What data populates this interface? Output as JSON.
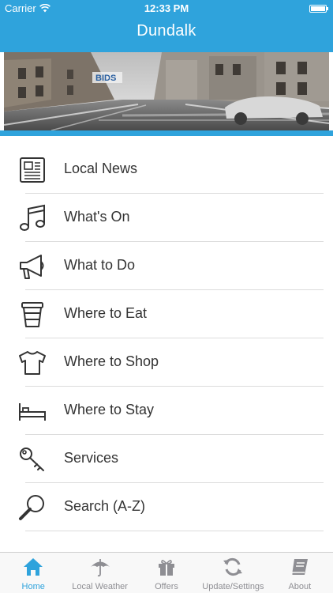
{
  "status_bar": {
    "carrier": "Carrier",
    "time": "12:33 PM"
  },
  "nav": {
    "title": "Dundalk"
  },
  "banner": {
    "logo_text": "BIDS"
  },
  "menu": [
    {
      "label": "Local News",
      "icon": "newspaper-icon"
    },
    {
      "label": "What's On",
      "icon": "music-note-icon"
    },
    {
      "label": "What to Do",
      "icon": "megaphone-icon"
    },
    {
      "label": "Where to Eat",
      "icon": "coffee-cup-icon"
    },
    {
      "label": "Where to Shop",
      "icon": "tshirt-icon"
    },
    {
      "label": "Where to Stay",
      "icon": "bed-icon"
    },
    {
      "label": "Services",
      "icon": "key-icon"
    },
    {
      "label": "Search (A-Z)",
      "icon": "search-icon"
    }
  ],
  "tabs": [
    {
      "label": "Home",
      "icon": "home-icon",
      "active": true
    },
    {
      "label": "Local Weather",
      "icon": "umbrella-icon",
      "active": false
    },
    {
      "label": "Offers",
      "icon": "gift-icon",
      "active": false
    },
    {
      "label": "Update/Settings",
      "icon": "refresh-icon",
      "active": false
    },
    {
      "label": "About",
      "icon": "book-icon",
      "active": false
    }
  ],
  "colors": {
    "accent": "#2fa3dc",
    "icon_stroke": "#333333",
    "tab_inactive": "#8e8e93"
  }
}
